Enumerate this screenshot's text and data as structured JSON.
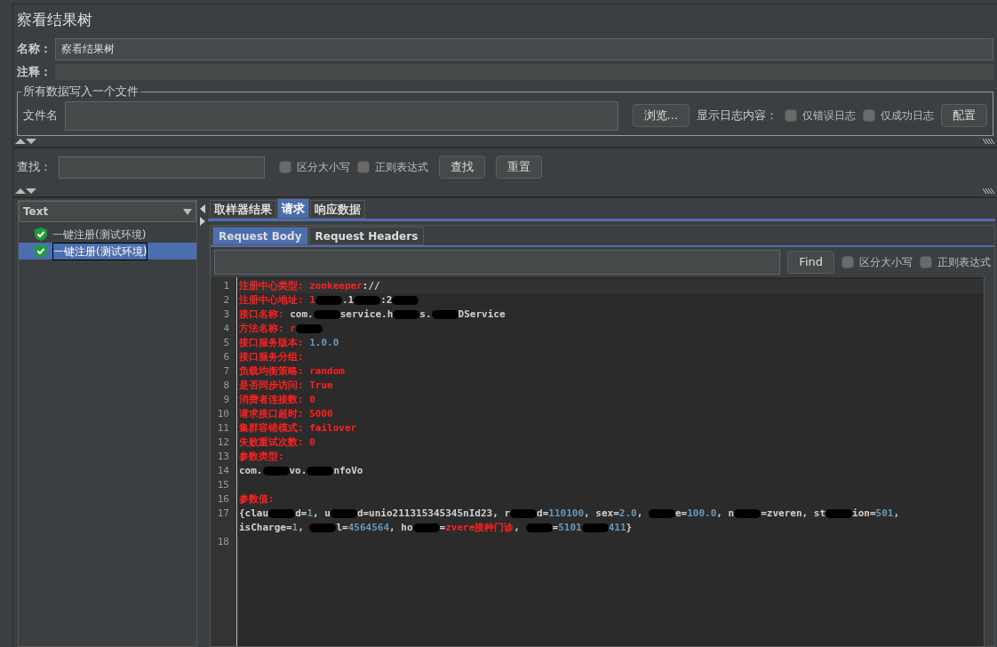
{
  "window": {
    "title": "察看结果树"
  },
  "name_field": {
    "label": "名称：",
    "value": "察看结果树"
  },
  "comment_field": {
    "label": "注释："
  },
  "file_group": {
    "legend": "所有数据写入一个文件",
    "label": "文件名",
    "browse": "浏览...",
    "log_label": "显示日志内容：",
    "options": [
      {
        "label": "仅错误日志",
        "checked": false
      },
      {
        "label": "仅成功日志",
        "checked": false
      }
    ],
    "config": "配置"
  },
  "search": {
    "label": "查找：",
    "options": [
      {
        "label": "区分大小写",
        "checked": false
      },
      {
        "label": "正则表达式",
        "checked": false
      }
    ],
    "buttons": [
      "查找",
      "重置"
    ]
  },
  "renderer": {
    "value": "Text"
  },
  "tree": [
    {
      "label": "一键注册(测试环境)",
      "selected": false
    },
    {
      "label": "一键注册(测试环境)",
      "selected": true
    }
  ],
  "tabs": [
    {
      "label": "取样器结果",
      "selected": false
    },
    {
      "label": "请求",
      "selected": true
    },
    {
      "label": "响应数据",
      "selected": false
    }
  ],
  "subtabs": [
    {
      "label": "Request Body",
      "selected": true
    },
    {
      "label": "Request Headers",
      "selected": false
    }
  ],
  "find": {
    "button": "Find",
    "options": [
      {
        "label": "区分大小写",
        "checked": false
      },
      {
        "label": "正则表达式",
        "checked": false
      }
    ]
  },
  "code_lines": [
    {
      "number": "1",
      "segments": [
        {
          "kind": "text",
          "color": "#ff2020",
          "text": "注册中心类型: zookeeper"
        },
        {
          "kind": "text",
          "text": "://"
        }
      ]
    },
    {
      "number": "2",
      "segments": [
        {
          "kind": "text",
          "color": "#ff2020",
          "text": "注册中心地址: 1"
        },
        {
          "kind": "redacted"
        },
        {
          "kind": "text",
          "text": ".1"
        },
        {
          "kind": "redacted"
        },
        {
          "kind": "text",
          "text": ":2"
        },
        {
          "kind": "redacted"
        }
      ]
    },
    {
      "number": "3",
      "segments": [
        {
          "kind": "text",
          "color": "#ff2020",
          "text": "接口名称: "
        },
        {
          "kind": "text",
          "text": "com."
        },
        {
          "kind": "redacted"
        },
        {
          "kind": "text",
          "text": "service.h"
        },
        {
          "kind": "redacted"
        },
        {
          "kind": "text",
          "text": "s."
        },
        {
          "kind": "redacted"
        },
        {
          "kind": "text",
          "text": "DService"
        }
      ]
    },
    {
      "number": "4",
      "segments": [
        {
          "kind": "text",
          "color": "#ff2020",
          "text": "方法名称: r"
        },
        {
          "kind": "redacted"
        }
      ]
    },
    {
      "number": "5",
      "segments": [
        {
          "kind": "text",
          "color": "#ff2020",
          "text": "接口服务版本: "
        },
        {
          "kind": "text",
          "color": "#6897bb",
          "text": "1.0.0"
        }
      ]
    },
    {
      "number": "6",
      "segments": [
        {
          "kind": "text",
          "color": "#ff2020",
          "text": "接口服务分组:"
        }
      ]
    },
    {
      "number": "7",
      "segments": [
        {
          "kind": "text",
          "color": "#ff2020",
          "text": "负载均衡策略: random"
        }
      ]
    },
    {
      "number": "8",
      "segments": [
        {
          "kind": "text",
          "color": "#ff2020",
          "text": "是否同步访问: True"
        }
      ]
    },
    {
      "number": "9",
      "segments": [
        {
          "kind": "text",
          "color": "#ff2020",
          "text": "消费者连接数: 0"
        }
      ]
    },
    {
      "number": "10",
      "segments": [
        {
          "kind": "text",
          "color": "#ff2020",
          "text": "请求接口超时: 5000"
        }
      ]
    },
    {
      "number": "11",
      "segments": [
        {
          "kind": "text",
          "color": "#ff2020",
          "text": "集群容错模式: failover"
        }
      ]
    },
    {
      "number": "12",
      "segments": [
        {
          "kind": "text",
          "color": "#ff2020",
          "text": "失败重试次数: 0"
        }
      ]
    },
    {
      "number": "13",
      "segments": [
        {
          "kind": "text",
          "color": "#ff2020",
          "text": "参数类型:"
        }
      ]
    },
    {
      "number": "14",
      "segments": [
        {
          "kind": "text",
          "text": "com."
        },
        {
          "kind": "redacted"
        },
        {
          "kind": "text",
          "text": "vo."
        },
        {
          "kind": "redacted"
        },
        {
          "kind": "text",
          "text": "nfoVo"
        }
      ]
    },
    {
      "number": "15"
    },
    {
      "number": "16",
      "segments": [
        {
          "kind": "text",
          "color": "#ff2020",
          "text": "参数值:"
        }
      ]
    },
    {
      "number": "17",
      "segments": [
        {
          "kind": "text",
          "text": "{clau"
        },
        {
          "kind": "redacted"
        },
        {
          "kind": "text",
          "text": "d="
        },
        {
          "kind": "text",
          "color": "#6897bb",
          "text": "1"
        },
        {
          "kind": "text",
          "text": ", u"
        },
        {
          "kind": "redacted"
        },
        {
          "kind": "text",
          "text": "d=unio211315345345nId23, r"
        },
        {
          "kind": "redacted"
        },
        {
          "kind": "text",
          "text": "d="
        },
        {
          "kind": "text",
          "color": "#6897bb",
          "text": "110100"
        },
        {
          "kind": "text",
          "text": ", sex="
        },
        {
          "kind": "text",
          "color": "#6897bb",
          "text": "2.0"
        },
        {
          "kind": "text",
          "text": ", "
        },
        {
          "kind": "redacted"
        },
        {
          "kind": "text",
          "text": "e="
        },
        {
          "kind": "text",
          "color": "#6897bb",
          "text": "100.0"
        },
        {
          "kind": "text",
          "text": ", n"
        },
        {
          "kind": "redacted"
        },
        {
          "kind": "text",
          "text": "=zveren, st"
        },
        {
          "kind": "redacted"
        },
        {
          "kind": "text",
          "text": "ion="
        },
        {
          "kind": "text",
          "color": "#6897bb",
          "text": "501"
        },
        {
          "kind": "text",
          "text": ","
        }
      ]
    },
    {
      "segments": [
        {
          "kind": "text",
          "text": "isCharge="
        },
        {
          "kind": "text",
          "color": "#6897bb",
          "text": "1"
        },
        {
          "kind": "text",
          "text": ", "
        },
        {
          "kind": "redacted"
        },
        {
          "kind": "text",
          "text": "l="
        },
        {
          "kind": "text",
          "color": "#6897bb",
          "text": "4564564"
        },
        {
          "kind": "text",
          "text": ", ho"
        },
        {
          "kind": "redacted"
        },
        {
          "kind": "text",
          "text": "="
        },
        {
          "kind": "text",
          "color": "#ff2020",
          "text": "zvere接种门诊"
        },
        {
          "kind": "text",
          "text": ", "
        },
        {
          "kind": "redacted"
        },
        {
          "kind": "text",
          "text": "="
        },
        {
          "kind": "text",
          "color": "#6897bb",
          "text": "5101"
        },
        {
          "kind": "redacted"
        },
        {
          "kind": "text",
          "color": "#6897bb",
          "text": "411"
        },
        {
          "kind": "text",
          "text": "}"
        }
      ]
    },
    {
      "number": "18"
    }
  ]
}
